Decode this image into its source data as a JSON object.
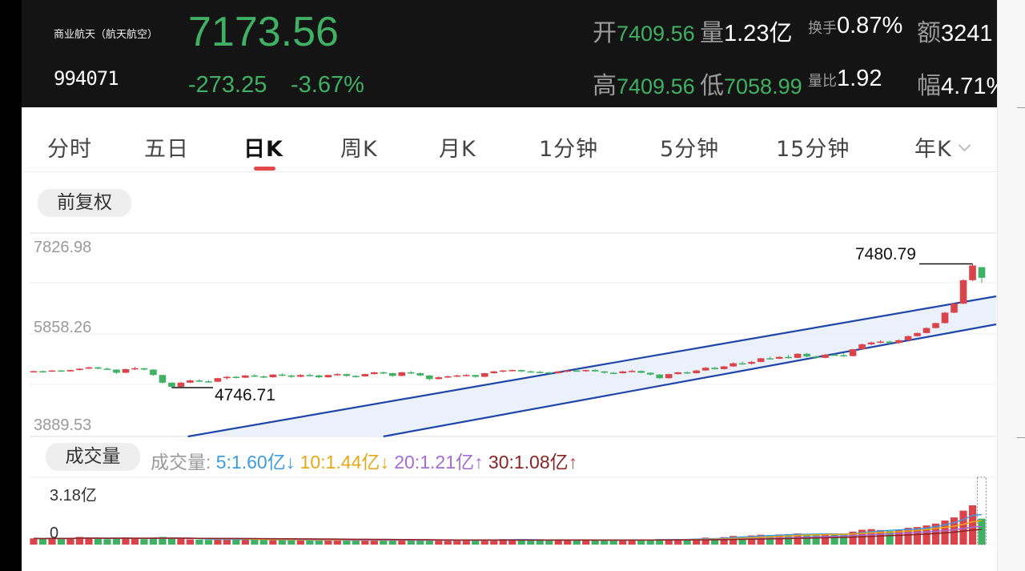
{
  "header": {
    "name": "商业航天（航天航空）",
    "code": "994071",
    "price": "7173.56",
    "change": "-273.25",
    "change_pct": "-3.67%",
    "open_label": "开",
    "open": "7409.56",
    "volume_label": "量",
    "volume": "1.23亿",
    "turnover_label": "换手",
    "turnover": "0.87%",
    "amount_label": "额",
    "amount": "3241",
    "high_label": "高",
    "high": "7409.56",
    "low_label": "低",
    "low": "7058.99",
    "vol_ratio_label": "量比",
    "vol_ratio": "1.92",
    "amplitude_label": "幅",
    "amplitude": "4.71%"
  },
  "tabs": [
    {
      "label": "分时"
    },
    {
      "label": "五日"
    },
    {
      "label": "日K"
    },
    {
      "label": "周K"
    },
    {
      "label": "月K"
    },
    {
      "label": "1分钟"
    },
    {
      "label": "5分钟"
    },
    {
      "label": "15分钟"
    },
    {
      "label": "年K"
    }
  ],
  "active_tab": "日K",
  "adjust_label": "前复权",
  "price_axis": {
    "top": "7826.98",
    "mid": "5858.26",
    "bottom": "3889.53"
  },
  "annotations": {
    "max": "7480.79",
    "min": "4746.71"
  },
  "volume": {
    "pill": "成交量",
    "prefix": "成交量:",
    "ma5": "5:1.60亿",
    "ma10": "10:1.44亿",
    "ma20": "20:1.21亿",
    "ma30": "30:1.08亿",
    "max_label": "3.18亿",
    "zero_label": "0"
  },
  "colors": {
    "up": "#d9444b",
    "down": "#3fb064",
    "channel": "#1f45a8",
    "ma5": "#3d9be0",
    "ma10": "#e6a817",
    "ma20": "#a56bd6",
    "ma30": "#8b2323"
  },
  "chart_data": {
    "type": "candlestick",
    "price_range": [
      3889.53,
      7826.98
    ],
    "volume_max": 3.18,
    "ohlc": [
      [
        5100,
        5120,
        5080,
        5105
      ],
      [
        5105,
        5115,
        5085,
        5095
      ],
      [
        5095,
        5130,
        5090,
        5120
      ],
      [
        5120,
        5130,
        5095,
        5100
      ],
      [
        5100,
        5140,
        5095,
        5130
      ],
      [
        5130,
        5170,
        5120,
        5160
      ],
      [
        5160,
        5200,
        5150,
        5190
      ],
      [
        5190,
        5200,
        5150,
        5160
      ],
      [
        5160,
        5190,
        5130,
        5140
      ],
      [
        5140,
        5150,
        5040,
        5070
      ],
      [
        5070,
        5160,
        5060,
        5150
      ],
      [
        5150,
        5200,
        5130,
        5170
      ],
      [
        5170,
        5180,
        5120,
        5140
      ],
      [
        5140,
        5150,
        5000,
        5020
      ],
      [
        5020,
        5030,
        4830,
        4850
      ],
      [
        4850,
        4860,
        4740,
        4760
      ],
      [
        4760,
        4870,
        4747,
        4850
      ],
      [
        4850,
        4920,
        4840,
        4900
      ],
      [
        4900,
        4930,
        4860,
        4880
      ],
      [
        4880,
        4910,
        4850,
        4870
      ],
      [
        4870,
        4960,
        4860,
        4950
      ],
      [
        4950,
        5000,
        4920,
        4980
      ],
      [
        4980,
        5000,
        4940,
        4960
      ],
      [
        4960,
        5020,
        4950,
        5010
      ],
      [
        5010,
        5040,
        4970,
        4990
      ],
      [
        4990,
        5010,
        4950,
        4970
      ],
      [
        4970,
        5040,
        4960,
        5030
      ],
      [
        5030,
        5060,
        4990,
        5010
      ],
      [
        5010,
        5030,
        4950,
        4980
      ],
      [
        4980,
        5040,
        4970,
        5020
      ],
      [
        5020,
        5050,
        4990,
        5010
      ],
      [
        5010,
        5030,
        4950,
        4970
      ],
      [
        4970,
        5030,
        4960,
        5020
      ],
      [
        5020,
        5060,
        5000,
        5040
      ],
      [
        5040,
        5050,
        4980,
        5000
      ],
      [
        5000,
        5020,
        4960,
        4990
      ],
      [
        4990,
        5050,
        4980,
        5040
      ],
      [
        5040,
        5090,
        5030,
        5080
      ],
      [
        5080,
        5100,
        5040,
        5060
      ],
      [
        5060,
        5070,
        4980,
        5000
      ],
      [
        5000,
        5090,
        4990,
        5080
      ],
      [
        5080,
        5110,
        5040,
        5060
      ],
      [
        5060,
        5080,
        4990,
        5010
      ],
      [
        5010,
        5020,
        4900,
        4930
      ],
      [
        4930,
        4990,
        4920,
        4970
      ],
      [
        4970,
        5010,
        4950,
        4990
      ],
      [
        4990,
        5030,
        4970,
        5010
      ],
      [
        5010,
        5040,
        4990,
        5020
      ],
      [
        5020,
        5030,
        4960,
        4980
      ],
      [
        4980,
        5070,
        4970,
        5060
      ],
      [
        5060,
        5110,
        5050,
        5100
      ],
      [
        5100,
        5130,
        5080,
        5120
      ],
      [
        5120,
        5140,
        5100,
        5130
      ],
      [
        5130,
        5140,
        5080,
        5100
      ],
      [
        5100,
        5120,
        5070,
        5090
      ],
      [
        5090,
        5110,
        5060,
        5080
      ],
      [
        5080,
        5090,
        5040,
        5060
      ],
      [
        5060,
        5110,
        5050,
        5100
      ],
      [
        5100,
        5130,
        5080,
        5120
      ],
      [
        5120,
        5150,
        5090,
        5110
      ],
      [
        5110,
        5140,
        5090,
        5130
      ],
      [
        5130,
        5150,
        5090,
        5100
      ],
      [
        5100,
        5110,
        5050,
        5070
      ],
      [
        5070,
        5090,
        5040,
        5060
      ],
      [
        5060,
        5110,
        5050,
        5100
      ],
      [
        5100,
        5140,
        5080,
        5110
      ],
      [
        5110,
        5120,
        5060,
        5070
      ],
      [
        5070,
        5080,
        5010,
        5030
      ],
      [
        5030,
        5040,
        4930,
        4950
      ],
      [
        4950,
        5050,
        4940,
        5040
      ],
      [
        5040,
        5090,
        5030,
        5080
      ],
      [
        5080,
        5100,
        5040,
        5060
      ],
      [
        5060,
        5130,
        5050,
        5120
      ],
      [
        5120,
        5200,
        5110,
        5180
      ],
      [
        5180,
        5200,
        5140,
        5150
      ],
      [
        5150,
        5220,
        5140,
        5210
      ],
      [
        5210,
        5300,
        5200,
        5280
      ],
      [
        5280,
        5320,
        5250,
        5270
      ],
      [
        5270,
        5330,
        5250,
        5310
      ],
      [
        5310,
        5400,
        5300,
        5390
      ],
      [
        5390,
        5430,
        5370,
        5380
      ],
      [
        5380,
        5440,
        5370,
        5420
      ],
      [
        5420,
        5470,
        5380,
        5400
      ],
      [
        5400,
        5500,
        5390,
        5490
      ],
      [
        5490,
        5510,
        5410,
        5430
      ],
      [
        5430,
        5450,
        5380,
        5400
      ],
      [
        5400,
        5490,
        5390,
        5470
      ],
      [
        5470,
        5500,
        5450,
        5460
      ],
      [
        5460,
        5510,
        5420,
        5440
      ],
      [
        5440,
        5600,
        5430,
        5590
      ],
      [
        5590,
        5720,
        5580,
        5700
      ],
      [
        5700,
        5760,
        5680,
        5740
      ],
      [
        5740,
        5790,
        5720,
        5760
      ],
      [
        5760,
        5780,
        5700,
        5730
      ],
      [
        5730,
        5810,
        5710,
        5790
      ],
      [
        5790,
        5900,
        5780,
        5880
      ],
      [
        5880,
        5960,
        5870,
        5950
      ],
      [
        5950,
        6080,
        5940,
        6060
      ],
      [
        6060,
        6180,
        6050,
        6170
      ],
      [
        6170,
        6420,
        6160,
        6400
      ],
      [
        6400,
        6620,
        6390,
        6600
      ],
      [
        6600,
        7140,
        6590,
        7120
      ],
      [
        7120,
        7481,
        7100,
        7446
      ],
      [
        7409,
        7410,
        7059,
        7174
      ]
    ],
    "volumes": [
      0.5,
      0.46,
      0.55,
      0.48,
      0.5,
      0.62,
      0.55,
      0.48,
      0.44,
      0.52,
      0.58,
      0.5,
      0.44,
      0.56,
      0.62,
      0.52,
      0.46,
      0.42,
      0.4,
      0.38,
      0.44,
      0.48,
      0.4,
      0.42,
      0.38,
      0.36,
      0.4,
      0.38,
      0.35,
      0.37,
      0.36,
      0.34,
      0.36,
      0.38,
      0.35,
      0.33,
      0.36,
      0.38,
      0.34,
      0.36,
      0.4,
      0.36,
      0.34,
      0.38,
      0.33,
      0.35,
      0.34,
      0.36,
      0.33,
      0.38,
      0.42,
      0.44,
      0.4,
      0.38,
      0.36,
      0.35,
      0.34,
      0.38,
      0.4,
      0.36,
      0.38,
      0.35,
      0.33,
      0.34,
      0.38,
      0.4,
      0.36,
      0.35,
      0.44,
      0.42,
      0.45,
      0.4,
      0.48,
      0.56,
      0.52,
      0.6,
      0.7,
      0.66,
      0.74,
      0.8,
      0.76,
      0.82,
      0.85,
      0.9,
      0.86,
      0.8,
      0.88,
      0.84,
      0.86,
      1.05,
      1.2,
      1.25,
      1.18,
      1.1,
      1.22,
      1.36,
      1.42,
      1.55,
      1.7,
      1.95,
      2.2,
      2.75,
      3.18,
      2.1
    ]
  }
}
